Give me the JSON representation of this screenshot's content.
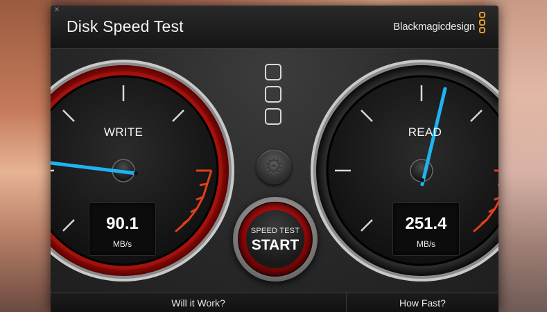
{
  "app": {
    "title": "Disk Speed Test",
    "brand": "Blackmagicdesign"
  },
  "write_gauge": {
    "label": "WRITE",
    "value": "90.1",
    "unit": "MB/s"
  },
  "read_gauge": {
    "label": "READ",
    "value": "251.4",
    "unit": "MB/s"
  },
  "start_button": {
    "line1": "SPEED TEST",
    "line2": "START"
  },
  "footer": {
    "left": "Will it Work?",
    "right": "How Fast?"
  },
  "colors": {
    "needle": "#1fb3f2",
    "accent_red": "#c81a12",
    "redline": "#e0401a",
    "brand_logo": "#e89a2c"
  }
}
